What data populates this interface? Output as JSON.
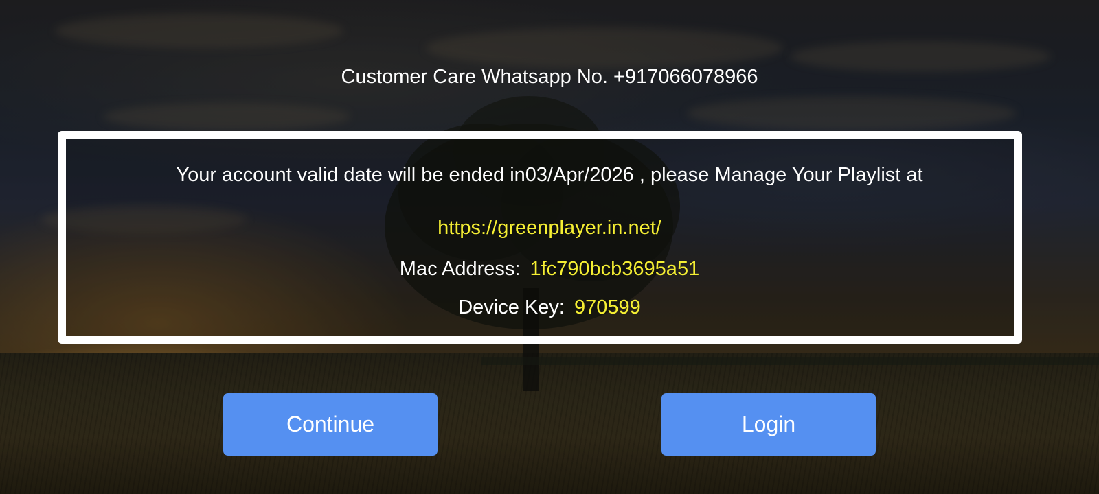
{
  "header": {
    "customer_care": "Customer Care Whatsapp No. +917066078966"
  },
  "info": {
    "expiry_message": "Your account valid date will be ended in03/Apr/2026 , please Manage Your Playlist at",
    "url": "https://greenplayer.in.net/",
    "mac_label": "Mac Address:",
    "mac_value": "1fc790bcb3695a51",
    "device_key_label": "Device Key:",
    "device_key_value": "970599"
  },
  "buttons": {
    "continue_label": "Continue",
    "login_label": "Login"
  },
  "colors": {
    "accent_button": "#5590f1",
    "highlight_text": "#f5ef33",
    "primary_text": "#ffffff",
    "box_border": "#ffffff"
  }
}
